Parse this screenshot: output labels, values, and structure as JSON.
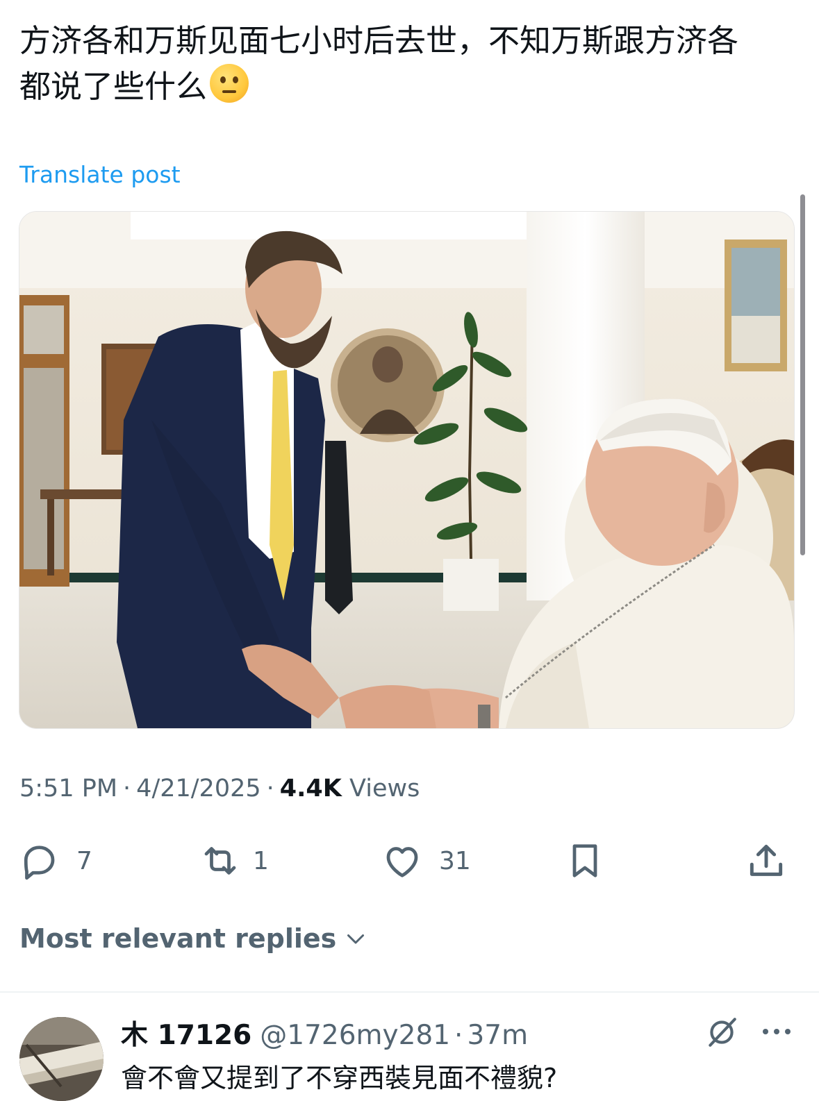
{
  "post": {
    "text_line1": "方济各和万斯见面七小时后去世，不知万斯跟方济各",
    "text_line2": "都说了些什么",
    "emoji": "thinking-face-emoji",
    "translate_label": "Translate post",
    "time": "5:51 PM",
    "sep1": "·",
    "date": "4/21/2025",
    "sep2": "·",
    "views_count": "4.4K",
    "views_label": "Views"
  },
  "actions": {
    "replies": "7",
    "reposts": "1",
    "likes": "31"
  },
  "replies_section": {
    "sort_label": "Most relevant replies"
  },
  "reply": {
    "name": "木 17126",
    "handle": "@1726my281",
    "sep": "·",
    "time": "37m",
    "text": "會不會又提到了不穿西裝見面不禮貌?"
  },
  "colors": {
    "link": "#1d9bf0",
    "secondary_text": "#536471",
    "primary_text": "#0f1419"
  }
}
